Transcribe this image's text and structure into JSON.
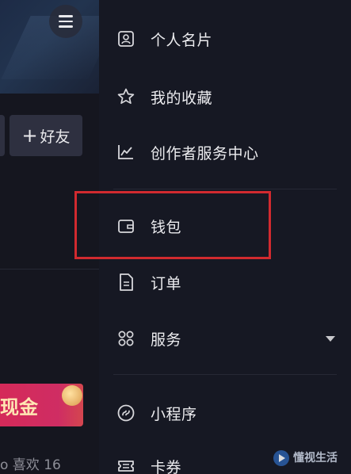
{
  "left_page": {
    "add_friend_label": "好友",
    "banner_text": "现金",
    "likes_text": "o 喜欢 16"
  },
  "drawer": {
    "items": [
      {
        "label": "个人名片",
        "icon": "id-card-icon"
      },
      {
        "label": "我的收藏",
        "icon": "star-icon"
      },
      {
        "label": "创作者服务中心",
        "icon": "chart-line-icon"
      },
      {
        "label": "钱包",
        "icon": "wallet-icon"
      },
      {
        "label": "订单",
        "icon": "document-icon"
      },
      {
        "label": "服务",
        "icon": "grid-icon",
        "has_dropdown": true
      },
      {
        "label": "小程序",
        "icon": "mini-program-icon"
      },
      {
        "label": "卡券",
        "icon": "coupon-icon"
      }
    ]
  },
  "watermark": {
    "text": "懂视生活"
  },
  "colors": {
    "background": "#161823",
    "highlight": "#d12a2f",
    "banner": "#d52a59"
  }
}
